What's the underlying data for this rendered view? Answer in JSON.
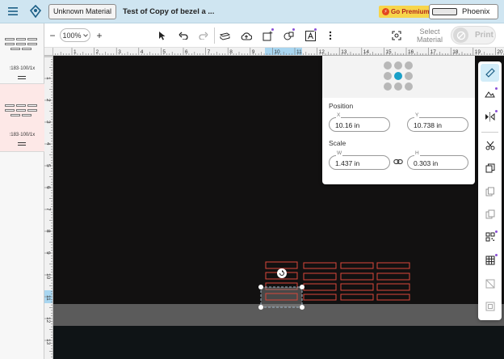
{
  "header": {
    "material_chip": "Unknown Material",
    "doc_title": "Test of Copy of bezel a ...",
    "premium_label": "Go Premium!",
    "machine_name": "Phoenix"
  },
  "layers": [
    {
      "settings": "183·100/1x",
      "active": false
    },
    {
      "settings": "183·100/1x",
      "active": true
    }
  ],
  "toolbar": {
    "zoom": "100%",
    "select_material": "Select Material",
    "print_label": "Print"
  },
  "rulers": {
    "top": [
      "1",
      "2",
      "3",
      "4",
      "5",
      "6",
      "7",
      "8",
      "9",
      "10",
      "11",
      "12",
      "13",
      "14",
      "15",
      "16",
      "17",
      "18",
      "19",
      "20"
    ],
    "left": [
      "1",
      "2",
      "3",
      "4",
      "5",
      "6",
      "7",
      "8",
      "9",
      "10",
      "11",
      "12",
      "13"
    ],
    "highlight_top": "10",
    "highlight_left": "11"
  },
  "props": {
    "position_label": "Position",
    "x_label": "X",
    "x_value": "10.16 in",
    "y_label": "Y",
    "y_value": "10.738 in",
    "scale_label": "Scale",
    "w_label": "W",
    "w_value": "1.437 in",
    "h_label": "H",
    "h_value": "0.303 in"
  },
  "colors": {
    "accent": "#1aa0c8",
    "cut_line": "#d9473c",
    "canvas": "#121111",
    "header_bg": "#cfe5f1"
  }
}
